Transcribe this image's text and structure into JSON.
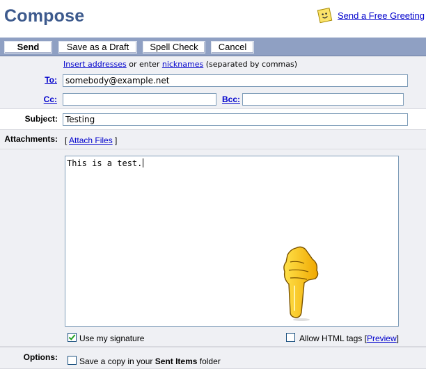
{
  "page": {
    "title": "Compose"
  },
  "greeting": {
    "label": "Send a Free Greeting"
  },
  "toolbar": {
    "send_label": "Send",
    "draft_label": "Save as a Draft",
    "spell_label": "Spell Check",
    "cancel_label": "Cancel"
  },
  "hint": {
    "insert_link": "Insert addresses",
    "middle_text": " or enter ",
    "nick_link": "nicknames",
    "end_text": " (separated by commas)"
  },
  "to": {
    "label": "To:",
    "value": "somebody@example.net"
  },
  "cc": {
    "label": "Cc:",
    "value": ""
  },
  "bcc": {
    "label": "Bcc:",
    "value": ""
  },
  "subject": {
    "label": "Subject:",
    "value": "Testing"
  },
  "attachments": {
    "label": "Attachments:",
    "open": "[ ",
    "link": "Attach Files",
    "close": " ]"
  },
  "body": {
    "text": "This is a test."
  },
  "signature": {
    "label": "Use my signature",
    "checked": true
  },
  "html_tags": {
    "label": "Allow HTML tags",
    "open": "[",
    "preview_link": "Preview",
    "close": "]",
    "checked": false
  },
  "options": {
    "label": "Options:",
    "save_copy_prefix": "Save a copy in your ",
    "save_copy_bold": "Sent Items",
    "save_copy_suffix": " folder"
  }
}
